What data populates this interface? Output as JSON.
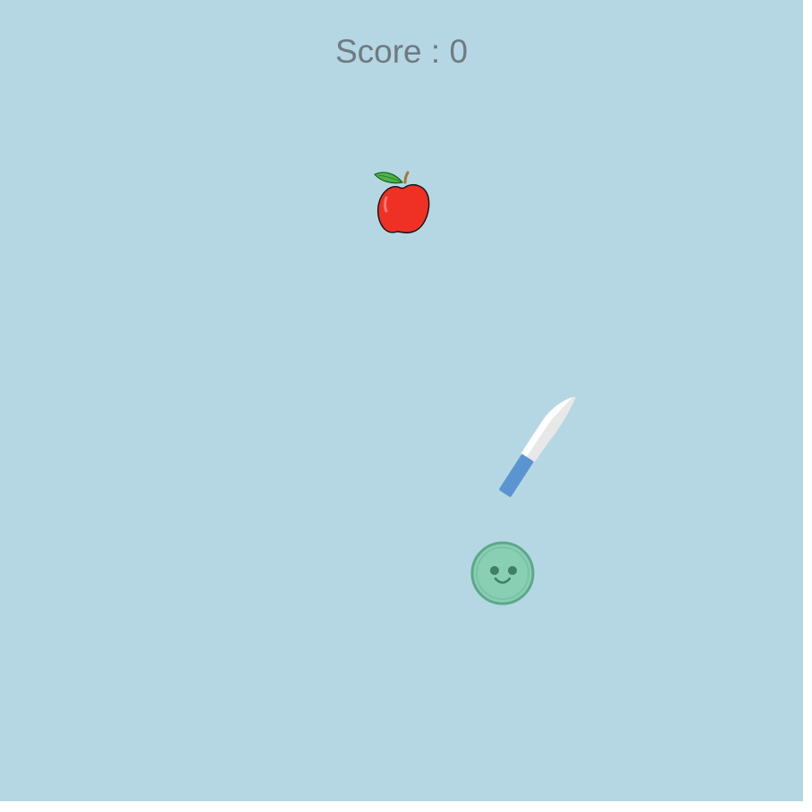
{
  "score": {
    "label": "Score : 0",
    "value": 0
  },
  "colors": {
    "background": "#b4d7e3",
    "score_text": "#6f7a80",
    "apple_red": "#ee3124",
    "leaf_green": "#4cb64a",
    "knife_blade": "#e8e8e8",
    "knife_handle": "#5b95d1",
    "player_face": "#88cfb3",
    "player_border": "#5da88a"
  },
  "sprites": {
    "target": "apple-icon",
    "weapon": "knife-icon",
    "player": "smiley-face-icon"
  }
}
